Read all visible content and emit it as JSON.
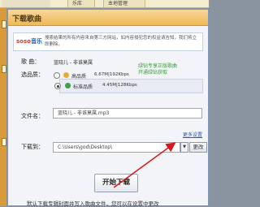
{
  "window_tabs": {
    "library": "乐库",
    "local": "本地管理"
  },
  "dialog": {
    "title": "下载歌曲",
    "soso_logo": "soso",
    "soso_logo_suffix": "音乐",
    "soso_text": "搜索结果的所有内容来自第三方网站，如内容侵犯您的权益请告知，我们将立即删除。",
    "song_label": "歌 曲：",
    "song_value": "蓝晓儿 - 非谁莫属",
    "quality_label": "选品质：",
    "hq_label": "高品质",
    "hq_info": "6.67M|192Kbps",
    "sq_label": "标准品质",
    "sq_info": "4.45M|128Kbps",
    "green_note_line1": "绿钻专享正版歌曲",
    "green_note_line2": "开通绿钻获取",
    "filename_label": "文件名：",
    "filename_value": "蓝晓儿 - 非谁莫属.mp3",
    "more_settings": "更多设置",
    "download_to_label": "下载到：",
    "download_path": "C:\\Users\\god\\Desktop\\",
    "dropdown_glyph": "▼",
    "browse_button": "更改",
    "start_button": "开始下载",
    "footer_text": "默认下载专辑封面并写入歌曲文件，您可以在设置中更改"
  }
}
